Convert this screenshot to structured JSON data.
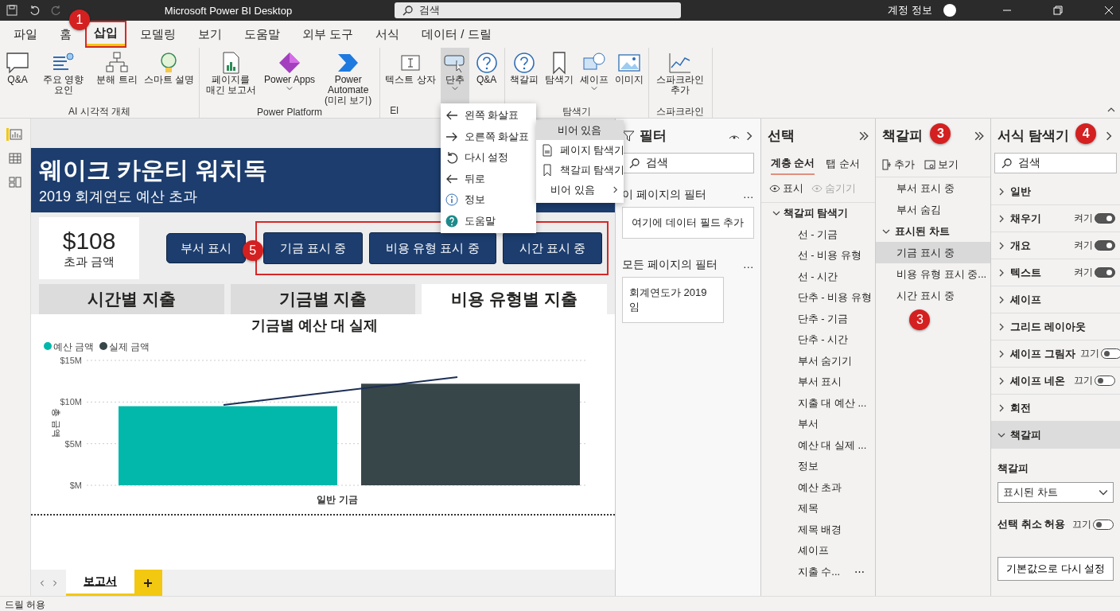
{
  "window": {
    "title": "Microsoft Power BI Desktop",
    "search": {
      "placeholder": "검색"
    },
    "account": "계정 정보"
  },
  "menu_tabs": [
    {
      "label": "파일",
      "selected": false
    },
    {
      "label": "홈",
      "selected": false
    },
    {
      "label": "삽입",
      "selected": true,
      "highlighted": true,
      "badge": "1"
    },
    {
      "label": "모델링",
      "selected": false
    },
    {
      "label": "보기",
      "selected": false
    },
    {
      "label": "도움말",
      "selected": false
    },
    {
      "label": "외부 도구",
      "selected": false
    },
    {
      "label": "서식",
      "selected": false
    },
    {
      "label": "데이터 / 드릴",
      "selected": false
    }
  ],
  "ribbon": {
    "groups": [
      {
        "label": "AI 시각적 개체",
        "items": [
          {
            "label": "Q&A"
          },
          {
            "label": "주요 영향 요인"
          },
          {
            "label": "분해 트리"
          },
          {
            "label": "스마트 설명"
          }
        ]
      },
      {
        "label": "Power Platform",
        "items": [
          {
            "label": "페이지를 매긴 보고서"
          },
          {
            "label": "Power Apps",
            "caret": true
          },
          {
            "label": "Power Automate (미리 보기)"
          }
        ]
      },
      {
        "label": "El",
        "items": [
          {
            "label": "텍스트 상자"
          },
          {
            "label": "단추",
            "caret": true,
            "expanded": true
          },
          {
            "label": "Q&A"
          }
        ]
      },
      {
        "label": "탐색기",
        "items": [
          {
            "label": "책갈피"
          },
          {
            "label": "탐색기"
          },
          {
            "label": "셰이프",
            "caret": true
          },
          {
            "label": "이미지"
          }
        ]
      },
      {
        "label": "스파크라인",
        "items": [
          {
            "label": "스파크라인 추가"
          }
        ]
      }
    ]
  },
  "button_menu": {
    "items": [
      {
        "label": "왼쪽 화살표"
      },
      {
        "label": "오른쪽 화살표",
        "submenu": true,
        "expanded": true
      },
      {
        "label": "다시 설정"
      },
      {
        "label": "뒤로"
      },
      {
        "label": "정보"
      },
      {
        "label": "도움말"
      }
    ],
    "submenu": [
      {
        "label": "비어 있음",
        "selected": true
      },
      {
        "label": "페이지 탐색기",
        "selected": false
      },
      {
        "label": "책갈피 탐색기",
        "selected": false
      },
      {
        "label": "비어 있음",
        "submenu": true,
        "selected": false
      }
    ]
  },
  "report": {
    "title": "웨이크 카운티 워치독",
    "subtitle": "2019 회계연도 예산 초과",
    "card": {
      "value": "$108",
      "label": "초과 금액"
    },
    "button": "부서 표시",
    "highlighted_group": {
      "badge": "5",
      "buttons": [
        "기금 표시 중",
        "비용 유형 표시 중",
        "시간 표시 중"
      ]
    },
    "tabs": [
      {
        "label": "시간별 지출",
        "selected": false
      },
      {
        "label": "기금별 지출",
        "selected": false
      },
      {
        "label": "비용 유형별 지출",
        "selected": true
      }
    ],
    "chart_data": {
      "type": "bar",
      "title": "기금별 예산 대 실제",
      "ylabel": "총 금액",
      "categories": [
        "일반 기금"
      ],
      "series": [
        {
          "name": "예산 금액",
          "color": "#01b8aa",
          "values": [
            9.5
          ]
        },
        {
          "name": "실제 금액",
          "color": "#374649",
          "values": [
            12.2
          ]
        }
      ],
      "legend": true,
      "ylim": [
        0,
        15
      ],
      "yticks": [
        {
          "value": 0,
          "label": "$M"
        },
        {
          "value": 5,
          "label": "$5M"
        },
        {
          "value": 10,
          "label": "$10M"
        },
        {
          "value": 15,
          "label": "$15M"
        }
      ]
    }
  },
  "page_tabs": [
    {
      "label": "보고서",
      "selected": true
    }
  ],
  "status_bar": "드릴 허용",
  "filters": {
    "title": "필터",
    "search": {
      "placeholder": "검색"
    },
    "this_page": {
      "title": "이 페이지의 필터",
      "more": "…",
      "drop_hint": "여기에 데이터 필드 추가"
    },
    "all_pages": {
      "title": "모든 페이지의 필터",
      "more": "…",
      "filter": "회계연도가 2019임"
    }
  },
  "selection": {
    "title": "선택",
    "tabs": [
      {
        "label": "계층 순서",
        "selected": true
      },
      {
        "label": "탭 순서",
        "selected": false
      }
    ],
    "actions": [
      {
        "label": "표시",
        "disabled": false
      },
      {
        "label": "숨기기",
        "disabled": true
      }
    ],
    "tree": [
      {
        "label": "책갈피 탐색기",
        "expanded": true,
        "children": [
          {
            "label": "선 - 기금"
          },
          {
            "label": "선 - 비용 유형"
          },
          {
            "label": "선 - 시간"
          },
          {
            "label": "단추 - 비용 유형"
          },
          {
            "label": "단추 - 기금"
          },
          {
            "label": "단추 - 시간"
          },
          {
            "label": "부서 숨기기"
          },
          {
            "label": "부서 표시"
          },
          {
            "label": "지출 대 예산 ..."
          },
          {
            "label": "부서"
          },
          {
            "label": "예산 대 실제 ..."
          },
          {
            "label": "정보"
          },
          {
            "label": "예산 초과"
          },
          {
            "label": "제목"
          },
          {
            "label": "제목 배경"
          },
          {
            "label": "셰이프"
          },
          {
            "label": "지출 수...",
            "more": "⋯"
          }
        ]
      }
    ]
  },
  "bookmarks": {
    "title": "책갈피",
    "badge": "3",
    "list_badge": "3",
    "actions": [
      "추가",
      "보기"
    ],
    "items": [
      {
        "label": "부서 표시 중",
        "selected": false
      },
      {
        "label": "부서 숨김",
        "selected": false
      },
      {
        "label": "표시된 차트",
        "expanded": true,
        "children": [
          {
            "label": "기금 표시 중",
            "selected": true
          },
          {
            "label": "비용 유형 표시 중...",
            "selected": false
          },
          {
            "label": "시간 표시 중",
            "selected": false
          }
        ]
      }
    ]
  },
  "format": {
    "title": "서식 탐색기",
    "badge": "4",
    "search": {
      "placeholder": "검색"
    },
    "sections": [
      {
        "label": "일반",
        "expanded": false
      },
      {
        "label": "채우기",
        "expanded": false,
        "toggle": {
          "label": "켜기",
          "on": true
        }
      },
      {
        "label": "개요",
        "expanded": false,
        "toggle": {
          "label": "켜기",
          "on": true
        }
      },
      {
        "label": "텍스트",
        "expanded": false,
        "toggle": {
          "label": "켜기",
          "on": true
        }
      },
      {
        "label": "셰이프",
        "expanded": false
      },
      {
        "label": "그리드 레이아웃",
        "expanded": false
      },
      {
        "label": "셰이프 그림자",
        "expanded": false,
        "toggle": {
          "label": "끄기",
          "on": false
        }
      },
      {
        "label": "셰이프 네온",
        "expanded": false,
        "toggle": {
          "label": "끄기",
          "on": false
        }
      },
      {
        "label": "회전",
        "expanded": false
      },
      {
        "label": "책갈피",
        "expanded": true
      }
    ],
    "bookmark_label": "책갈피",
    "bookmark_value": "표시된 차트",
    "deselect": {
      "label": "선택 취소 허용",
      "toggle": {
        "label": "끄기",
        "on": false
      }
    },
    "reset_button": "기본값으로 다시 설정"
  }
}
